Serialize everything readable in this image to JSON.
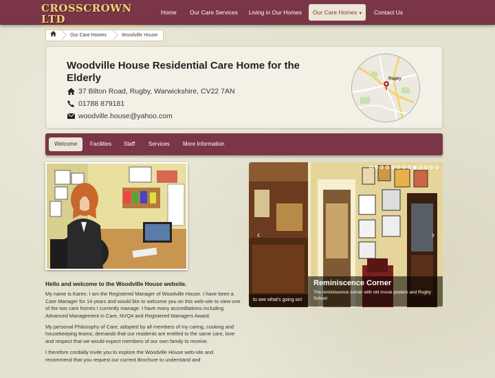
{
  "brand": {
    "name": "CROSSCROWN LTD",
    "tagline": "ADVANCING EXCELLENCE IN ELDERLY CARE"
  },
  "nav": {
    "items": [
      {
        "label": "Home"
      },
      {
        "label": "Our Care Services"
      },
      {
        "label": "Living in Our Homes"
      },
      {
        "label": "Our Care Homes",
        "active": true,
        "dropdown": true
      },
      {
        "label": "Contact Us"
      }
    ]
  },
  "breadcrumb": {
    "home_icon": "home-icon",
    "items": [
      "Our Care Homes",
      "Woodville House"
    ]
  },
  "home": {
    "title": "Woodville House Residential Care Home for the Elderly",
    "address": "37 Bilton Road, Rugby, Warwickshire, CV22 7AN",
    "phone": "01788 879181",
    "email": "woodville.house@yahoo.com",
    "map_label": "Rugby"
  },
  "subnav": {
    "items": [
      "Welcome",
      "Facilities",
      "Staff",
      "Services",
      "More Information"
    ],
    "active": "Welcome"
  },
  "welcome": {
    "heading": "Hello and welcome to the Woodville House website.",
    "paragraphs": [
      "My name is Karen. I am the Registered Manager of Woodville House. I have been a Care Manager for 14 years and would like to welcome you on this web-site to view one of the two care homes I currently manage. I have many accreditations including Advanced Management in Care, NVQ4 and Registered Managers Award.",
      "My personal Philosophy of Care, adopted by all members of my caring, cooking and housekeeping teams, demands that our residents are entitled to the same care, love and respect that we would expect members of our own family to receive.",
      "I therefore cordially invite you to explore the Woodville House web-site and recommend that you request our current Brochure to understand and"
    ]
  },
  "slider": {
    "slide_count": 13,
    "active_index": 8,
    "prev_caption": "to see what's going on!",
    "caption_title": "Reminiscence Corner",
    "caption_text": "The reminiscence corner with old movie posters and Rugby School"
  },
  "colors": {
    "navbar": "#7a3646",
    "brand_gold": "#efd37a",
    "active_tab_bg": "#ece6d6",
    "page_bg": "#e4e1cf"
  }
}
